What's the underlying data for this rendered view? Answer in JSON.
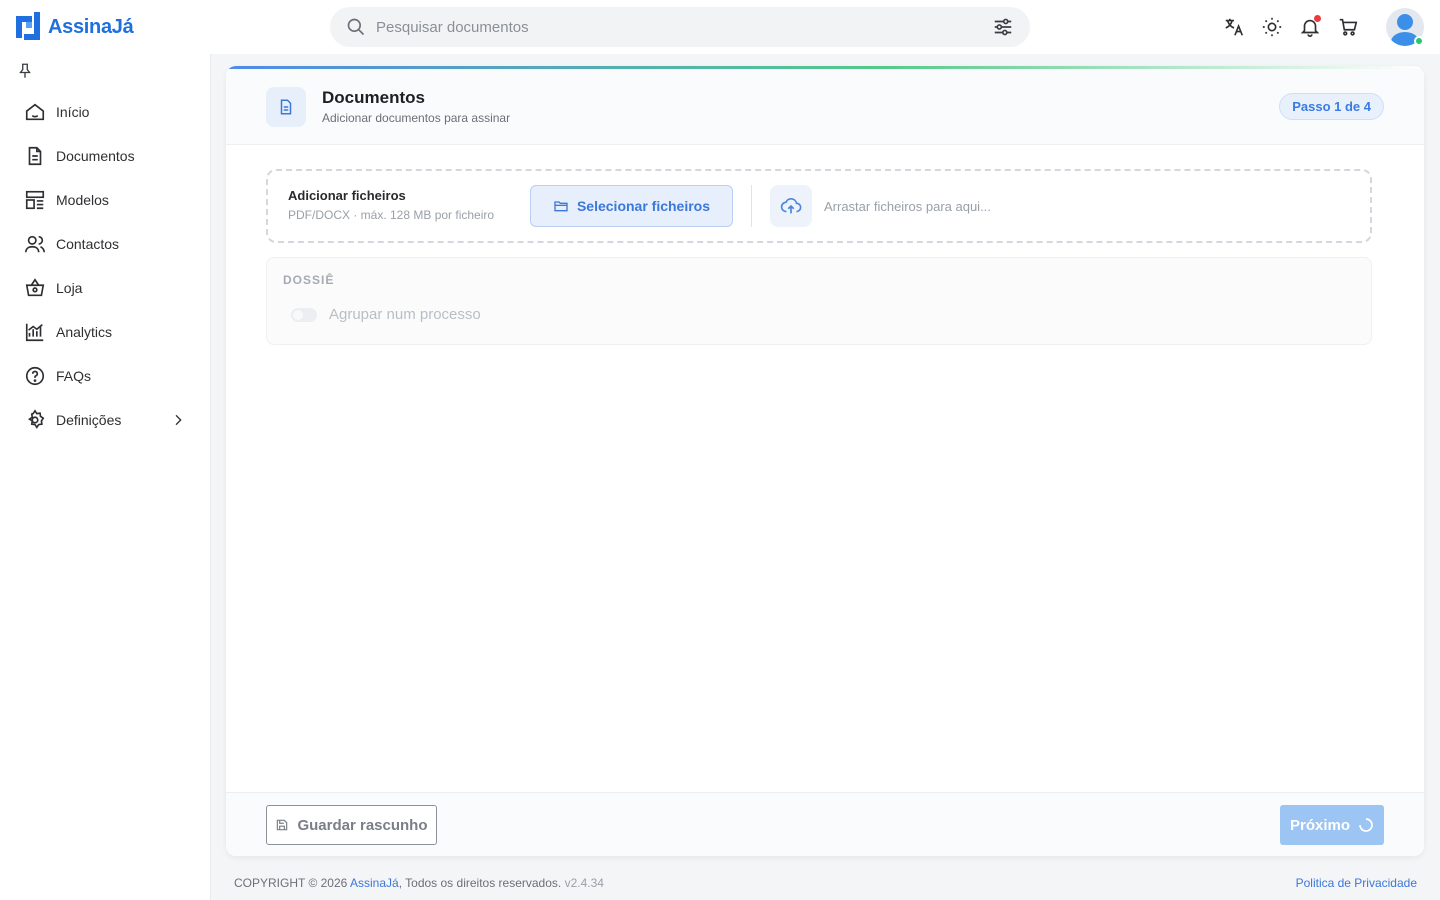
{
  "app": {
    "brand": "AssinaJá",
    "accent": "#1f6fe0"
  },
  "search": {
    "placeholder": "Pesquisar documentos",
    "value": ""
  },
  "topbar": {
    "icons": [
      "translate-icon",
      "sun-icon",
      "bell-icon",
      "cart-icon"
    ],
    "has_notification": true
  },
  "sidebar": {
    "items": [
      {
        "label": "Início",
        "icon": "home-icon"
      },
      {
        "label": "Documentos",
        "icon": "document-icon"
      },
      {
        "label": "Modelos",
        "icon": "templates-icon"
      },
      {
        "label": "Contactos",
        "icon": "contacts-icon"
      },
      {
        "label": "Loja",
        "icon": "basket-icon"
      },
      {
        "label": "Analytics",
        "icon": "analytics-icon"
      },
      {
        "label": "FAQs",
        "icon": "help-icon"
      },
      {
        "label": "Definições",
        "icon": "settings-icon"
      }
    ]
  },
  "card": {
    "title": "Documentos",
    "subtitle": "Adicionar documentos para assinar",
    "step": "Passo 1 de 4",
    "upload": {
      "title": "Adicionar ficheiros",
      "hint": "PDF/DOCX · máx. 128 MB por ficheiro",
      "select_label": "Selecionar ficheiros",
      "drop_text": "Arrastar ficheiros para aqui..."
    },
    "dossie": {
      "label": "DOSSIÊ",
      "toggle_label": "Agrupar num processo",
      "enabled": false
    },
    "footer": {
      "draft_label": "Guardar rascunho",
      "next_label": "Próximo"
    }
  },
  "page_footer": {
    "prefix": "COPYRIGHT © 2026 ",
    "brand": "AssinaJá",
    "suffix": ", Todos os direitos reservados.",
    "version": "v2.4.34",
    "privacy": "Politica de Privacidade"
  }
}
